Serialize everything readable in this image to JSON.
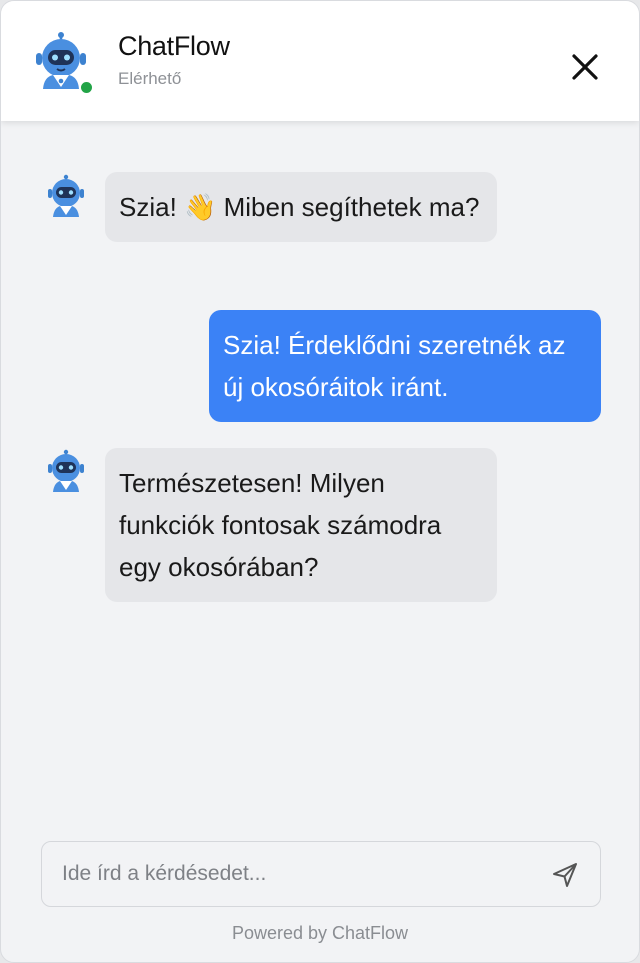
{
  "header": {
    "title": "ChatFlow",
    "status": "Elérhető",
    "status_color": "#22a447",
    "avatar_icon": "robot-icon",
    "close_icon": "close-icon"
  },
  "messages": [
    {
      "sender": "bot",
      "text": "Szia! 👋 Miben segíthetek ma?"
    },
    {
      "sender": "user",
      "text": "Szia! Érdeklődni szeretnék az új okosóráitok iránt."
    },
    {
      "sender": "bot",
      "text": "Természetesen! Milyen funkciók fontosak számodra egy okosórában?"
    }
  ],
  "input": {
    "placeholder": "Ide írd a kérdésedet...",
    "value": "",
    "send_icon": "send-icon"
  },
  "footer": {
    "powered_by": "Powered by ChatFlow"
  },
  "colors": {
    "user_bubble": "#3b82f6",
    "bot_bubble": "#e5e6e9",
    "background": "#f2f3f5"
  }
}
